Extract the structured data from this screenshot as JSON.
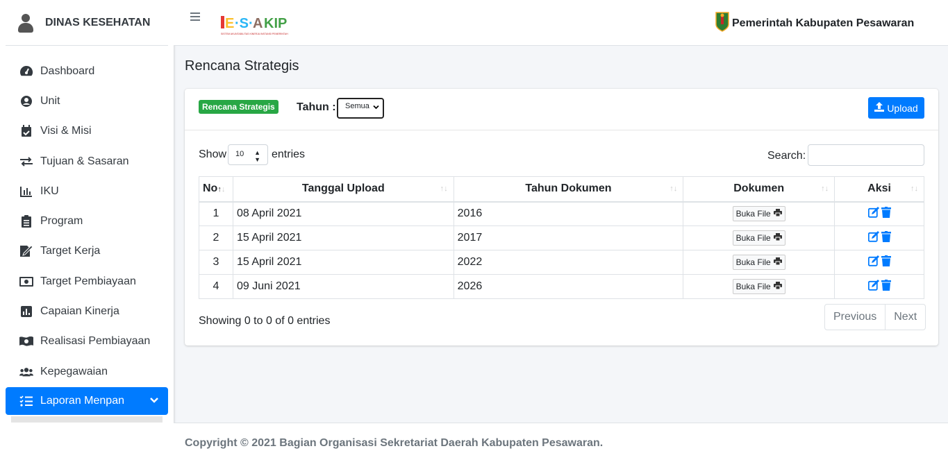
{
  "sidebar": {
    "brand": "DINAS KESEHATAN",
    "items": [
      {
        "label": "Dashboard",
        "icon": "dashboard-icon"
      },
      {
        "label": "Unit",
        "icon": "user-circle-icon"
      },
      {
        "label": "Visi & Misi",
        "icon": "calendar-check-icon"
      },
      {
        "label": "Tujuan & Sasaran",
        "icon": "exchange-icon"
      },
      {
        "label": "IKU",
        "icon": "bar-chart-icon"
      },
      {
        "label": "Program",
        "icon": "clipboard-list-icon"
      },
      {
        "label": "Target Kerja",
        "icon": "signature-icon"
      },
      {
        "label": "Target Pembiayaan",
        "icon": "money-bill-icon"
      },
      {
        "label": "Capaian Kinerja",
        "icon": "poll-icon"
      },
      {
        "label": "Realisasi Pembiayaan",
        "icon": "money-bill-wave-icon"
      },
      {
        "label": "Kepegawaian",
        "icon": "users-icon"
      },
      {
        "label": "Laporan Menpan",
        "icon": "tasks-icon"
      }
    ]
  },
  "header": {
    "logo_text": "ESAKIP",
    "logo_subtitle": "SISTEM AKUNTABILITAS KINERJA INSTANSI PEMERINTAH",
    "government": "Pemerintah Kabupaten Pesawaran"
  },
  "page": {
    "title": "Rencana Strategis",
    "badge": "Rencana Strategis",
    "tahun_label": "Tahun :",
    "tahun_value": "Semua",
    "upload_label": "Upload"
  },
  "table_controls": {
    "show": "Show",
    "entries_value": "10",
    "entries": "entries",
    "search": "Search:"
  },
  "table": {
    "headers": [
      "No",
      "Tanggal Upload",
      "Tahun Dokumen",
      "Dokumen",
      "Aksi"
    ],
    "button_label": "Buka File",
    "rows": [
      {
        "no": "1",
        "tanggal": "08 April 2021",
        "tahun": "2016"
      },
      {
        "no": "2",
        "tanggal": "15 April 2021",
        "tahun": "2017"
      },
      {
        "no": "3",
        "tanggal": "15 April 2021",
        "tahun": "2022"
      },
      {
        "no": "4",
        "tanggal": "09 Juni 2021",
        "tahun": "2026"
      }
    ]
  },
  "pagination": {
    "info": "Showing 0 to 0 of 0 entries",
    "previous": "Previous",
    "next": "Next"
  },
  "footer": {
    "copyright": "Copyright © 2021 Bagian Organisasi Sekretariat Daerah Kabupaten Pesawaran."
  },
  "colors": {
    "primary": "#007bff",
    "success": "#28a745",
    "text": "#343a40"
  }
}
